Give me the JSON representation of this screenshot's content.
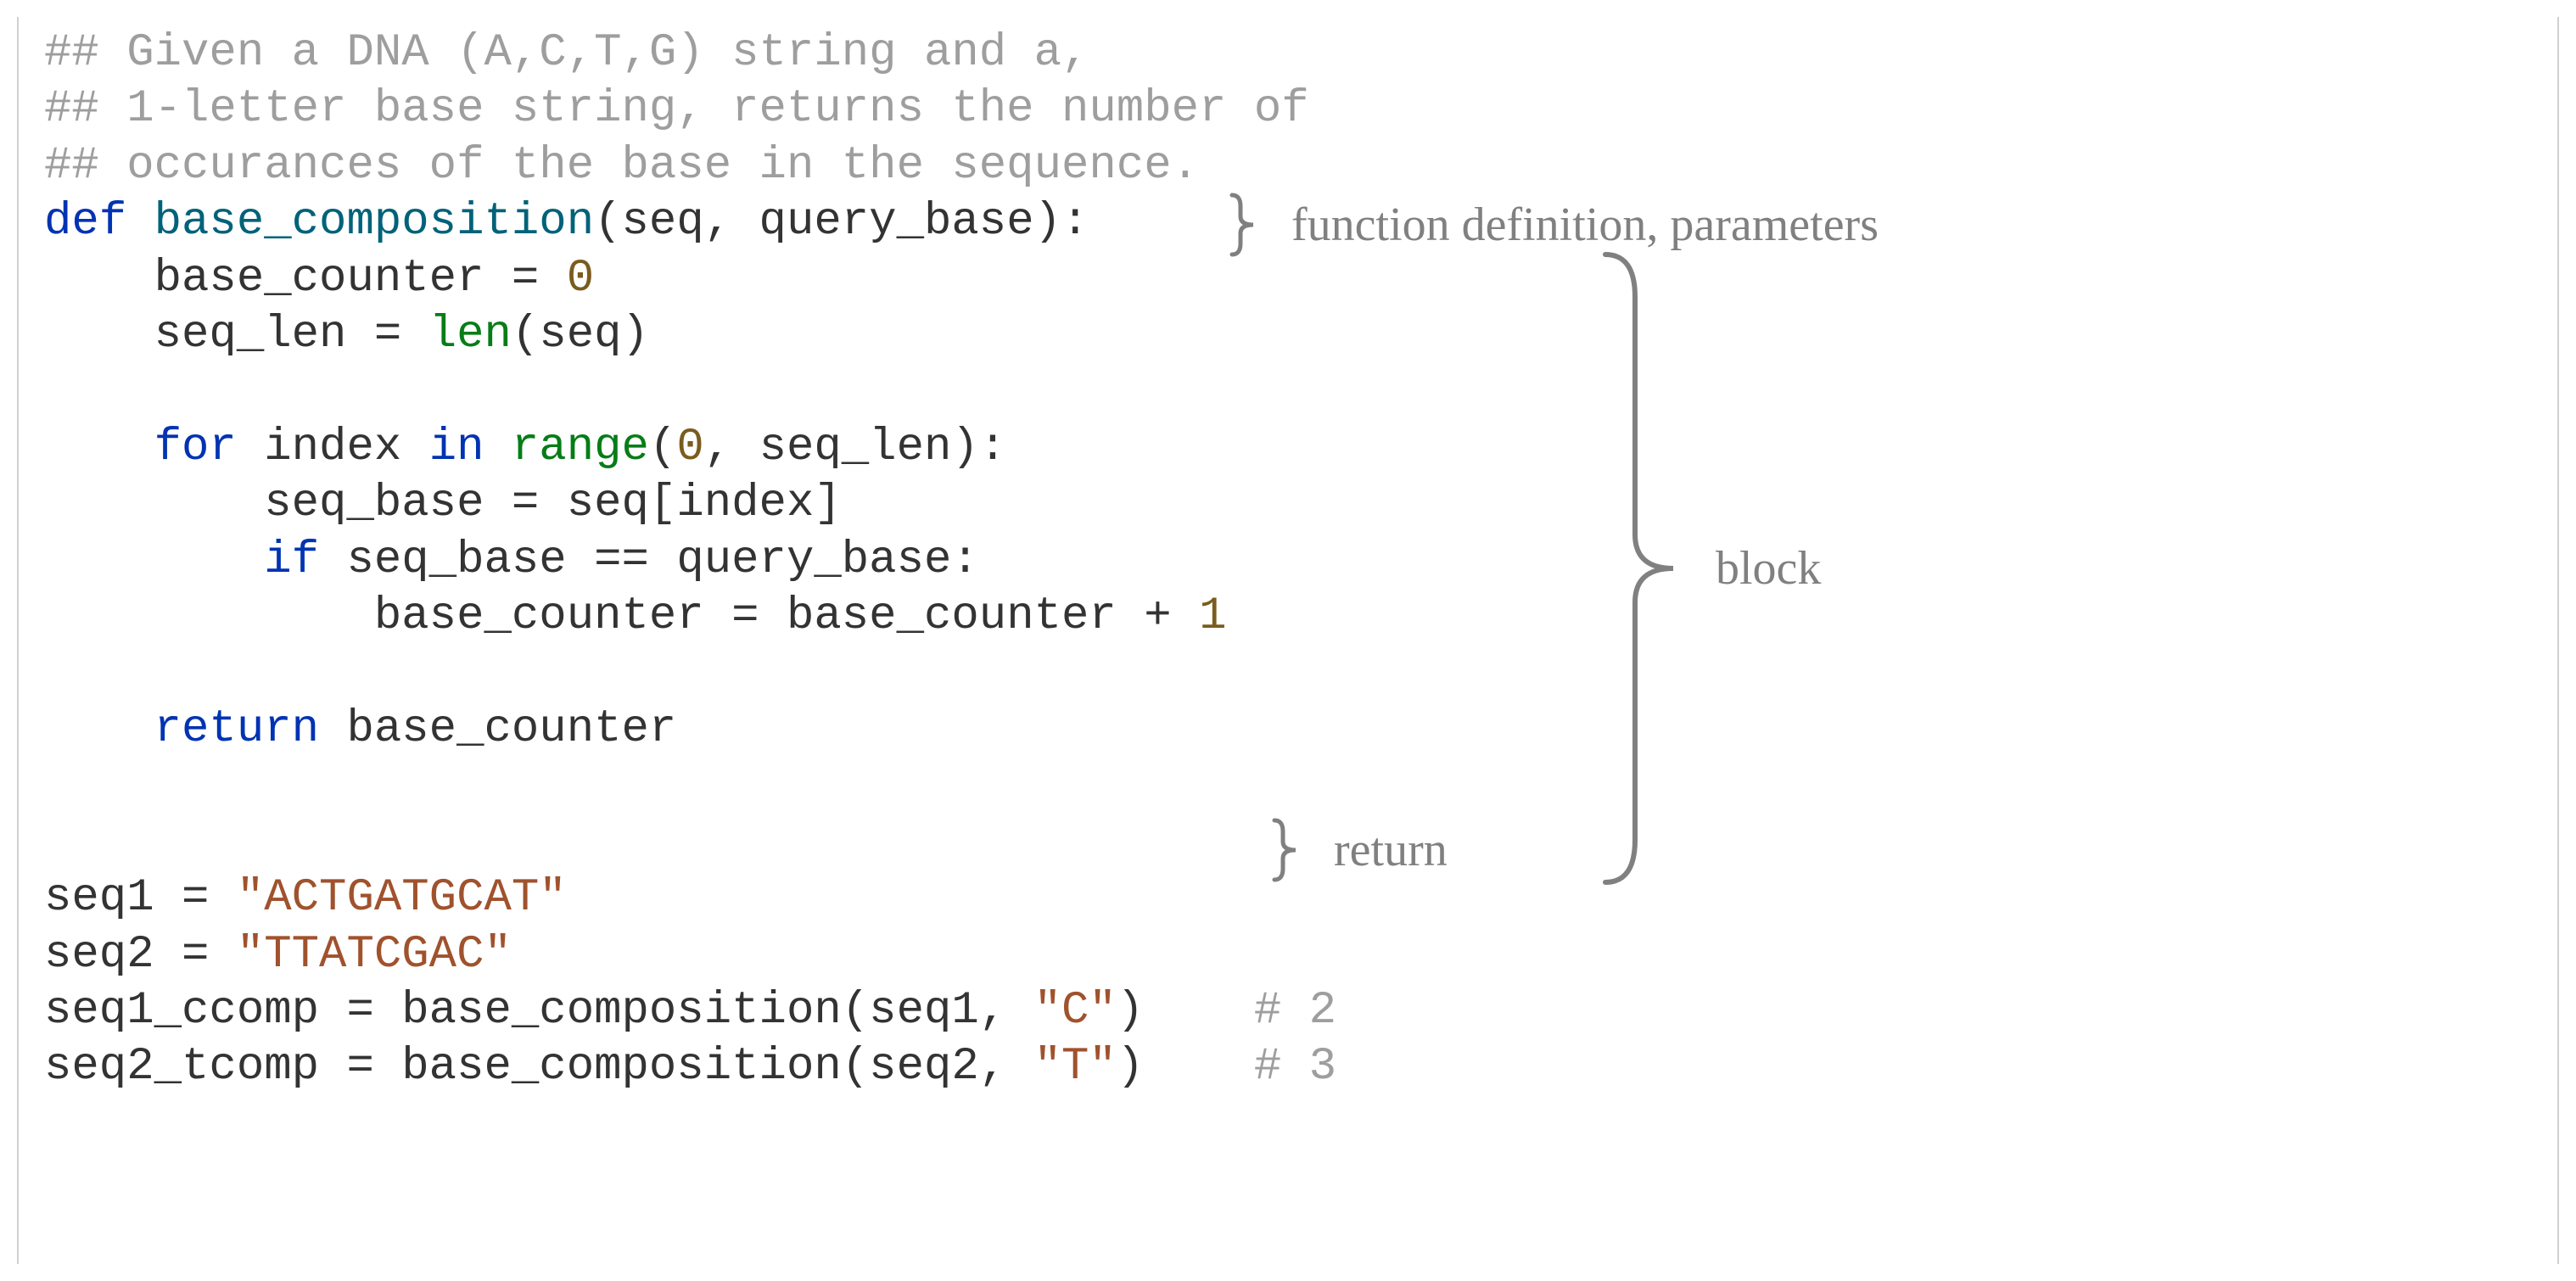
{
  "code": {
    "comment_lines": [
      "## Given a DNA (A,C,T,G) string and a,",
      "## 1-letter base string, returns the number of",
      "## occurances of the base in the sequence."
    ],
    "def_kw": "def",
    "func_name": "base_composition",
    "param1": "seq",
    "param2": "query_base",
    "body": {
      "l1_lhs": "base_counter",
      "l1_eq": " = ",
      "l1_rhs": "0",
      "l2_lhs": "seq_len",
      "l2_eq": " = ",
      "l2_fn": "len",
      "l2_arg": "seq",
      "for_kw": "for",
      "for_var": "index",
      "in_kw": "in",
      "range_fn": "range",
      "range_a": "0",
      "range_b": "seq_len",
      "l5_lhs": "seq_base",
      "l5_eq": " = ",
      "l5_rhs_obj": "seq",
      "l5_rhs_idx": "index",
      "if_kw": "if",
      "if_lhs": "seq_base",
      "if_op": " == ",
      "if_rhs": "query_base",
      "l7_lhs": "base_counter",
      "l7_eq": " = ",
      "l7_r1": "base_counter",
      "l7_plus": " + ",
      "l7_r2": "1",
      "return_kw": "return",
      "return_val": "base_counter"
    },
    "after": {
      "s1_lhs": "seq1",
      "s1_eq": " = ",
      "s1_str": "\"ACTGATGCAT\"",
      "s2_lhs": "seq2",
      "s2_eq": " = ",
      "s2_str": "\"TTATCGAC\"",
      "s3_lhs": "seq1_ccomp",
      "s3_eq": " = ",
      "s3_fn": "base_composition",
      "s3_a1": "seq1",
      "s3_a2": "\"C\"",
      "s3_pad": "    ",
      "s3_comment": "# 2",
      "s4_lhs": "seq2_tcomp",
      "s4_eq": " = ",
      "s4_fn": "base_composition",
      "s4_a1": "seq2",
      "s4_a2": "\"T\"",
      "s4_pad": "    ",
      "s4_comment": "# 3"
    }
  },
  "annotations": {
    "fn_def": "function definition, parameters",
    "block": "block",
    "return": "return"
  }
}
